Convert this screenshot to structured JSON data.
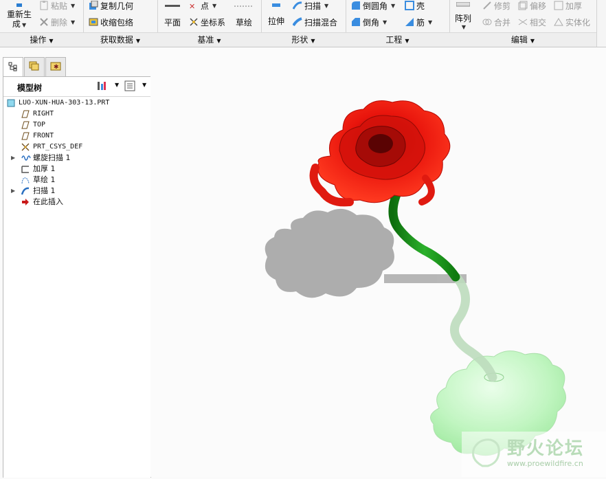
{
  "ribbon": {
    "groups": [
      {
        "id": "operations",
        "title": "操作"
      },
      {
        "id": "get_data",
        "title": "获取数据"
      },
      {
        "id": "datum",
        "title": "基准"
      },
      {
        "id": "shapes",
        "title": "形状"
      },
      {
        "id": "engineering",
        "title": "工程"
      },
      {
        "id": "editing",
        "title": "编辑"
      }
    ],
    "commands": {
      "regenerate_l1": "重新生",
      "regenerate_l2": "成",
      "paste": "粘贴",
      "delete": "删除",
      "copy_geometry": "复制几何",
      "shrinkwrap": "收缩包络",
      "plane": "平面",
      "point": "点",
      "csys": "坐标系",
      "sketch": "草绘",
      "extrude": "拉伸",
      "sweep": "扫描",
      "swept_blend": "扫描混合",
      "round": "倒圆角",
      "chamfer": "倒角",
      "shell": "壳",
      "rib": "筋",
      "pattern": "阵列",
      "trim": "修剪",
      "merge": "合并",
      "offset": "偏移",
      "intersect": "相交",
      "thicken": "加厚",
      "solidify": "实体化"
    }
  },
  "model_tree": {
    "title": "模型树",
    "items": [
      {
        "label": "LUO-XUN-HUA-303-13.PRT",
        "icon": "part-icon",
        "mono": true
      },
      {
        "label": "RIGHT",
        "icon": "datum-plane-icon",
        "mono": true
      },
      {
        "label": "TOP",
        "icon": "datum-plane-icon",
        "mono": true
      },
      {
        "label": "FRONT",
        "icon": "datum-plane-icon",
        "mono": true
      },
      {
        "label": "PRT_CSYS_DEF",
        "icon": "csys-icon",
        "mono": true
      },
      {
        "label": "螺旋扫描 1",
        "icon": "helical-sweep-icon",
        "expandable": true
      },
      {
        "label": "加厚 1",
        "icon": "thicken-icon"
      },
      {
        "label": "草绘 1",
        "icon": "sketch-icon"
      },
      {
        "label": "扫描 1",
        "icon": "sweep-icon",
        "expandable": true
      },
      {
        "label": "在此插入",
        "icon": "insert-here-icon"
      }
    ]
  },
  "watermark": {
    "title": "野火论坛",
    "url": "www.proewildfire.cn"
  },
  "colors": {
    "petal": "#e8140c",
    "stem": "#1f9a1f",
    "base": "#9fee9f",
    "shadow": "#a9a9a9"
  }
}
